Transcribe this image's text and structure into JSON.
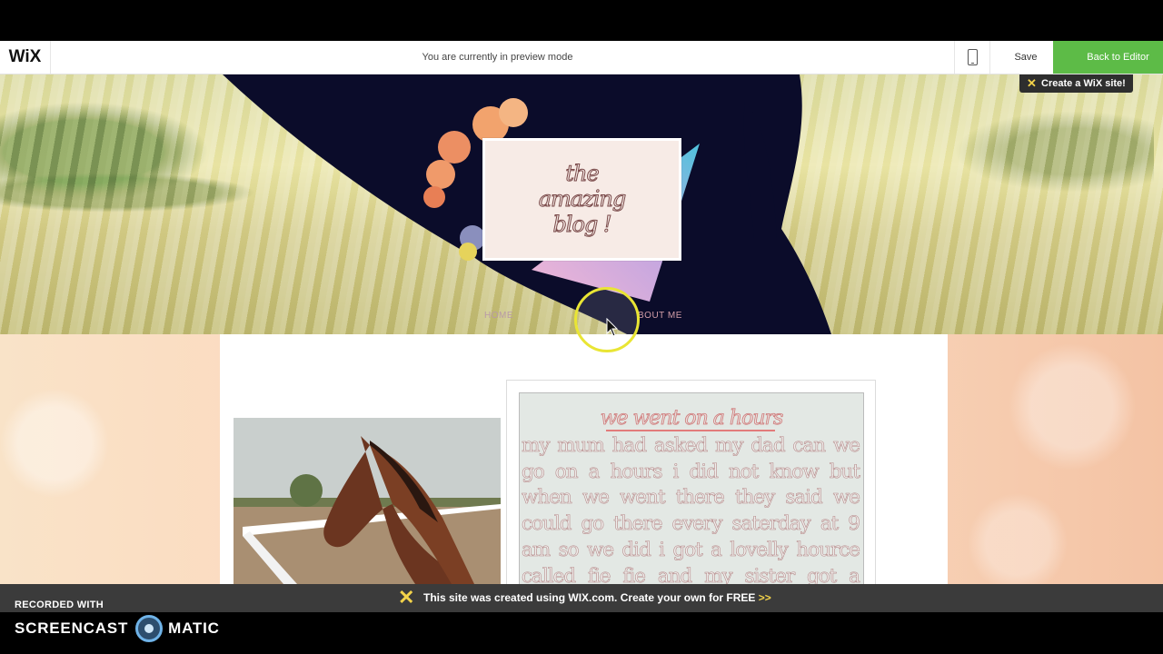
{
  "toolbar": {
    "logo": "WiX",
    "preview_text": "You are currently in preview mode",
    "save_label": "Save",
    "back_label": "Back to Editor",
    "mobile_icon": "mobile-phone-icon"
  },
  "site": {
    "create_badge": "Create a WiX site!",
    "logo_text": "the\namazing\nblog !",
    "nav": {
      "home": "HOME",
      "about": "BOUT ME"
    },
    "post": {
      "title": "we went on a hours",
      "body": "my mum had asked my dad can we go on a hours i did not know but when we went there they said we could go there every saterday at 9 am so we did i got a lovelly hource called fie fie and my sister got a hours called tommy and"
    }
  },
  "banner": {
    "text": "This site was created using WIX.com. Create your own for FREE",
    "arrows": ">>"
  },
  "recorder": {
    "recorded_with": "RECORDED WITH",
    "brand_left": "SCREENCAST",
    "brand_right": "MATIC"
  },
  "colors": {
    "accent_green": "#5dbb47",
    "badge_yellow": "#f3d34a",
    "cursor_ring": "#e9e534"
  }
}
